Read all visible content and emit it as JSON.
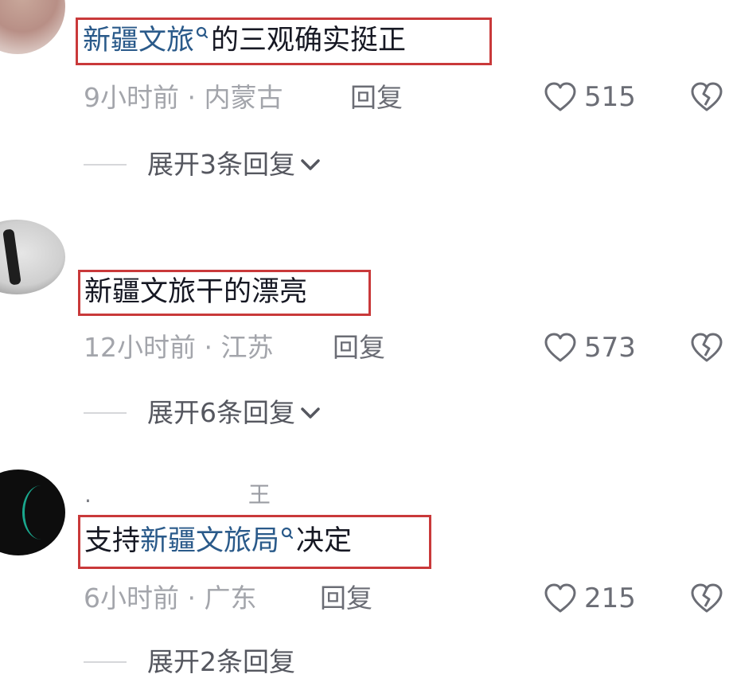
{
  "comments": [
    {
      "text_prefix": "",
      "highlight": "新疆文旅",
      "text_suffix": "的三观确实挺正",
      "time": "9小时前",
      "location": "内蒙古",
      "reply_label": "回复",
      "likes": "515",
      "expand_label": "展开3条回复"
    },
    {
      "text_prefix": "新疆文旅干的漂亮",
      "highlight": "",
      "text_suffix": "",
      "time": "12小时前",
      "location": "江苏",
      "reply_label": "回复",
      "likes": "573",
      "expand_label": "展开6条回复"
    },
    {
      "username_a": ".",
      "username_b": "王",
      "text_prefix": "支持",
      "highlight": "新疆文旅局",
      "text_suffix": "决定",
      "time": "6小时前",
      "location": "广东",
      "reply_label": "回复",
      "likes": "215",
      "expand_label": "展开2条回复"
    }
  ],
  "separator": "·",
  "colors": {
    "highlight_box": "#c9393a",
    "link_text": "#2a5a8a",
    "meta_text": "#a3a5ab"
  },
  "icons": [
    "search-icon",
    "heart-icon",
    "broken-heart-icon",
    "chevron-down-icon"
  ]
}
